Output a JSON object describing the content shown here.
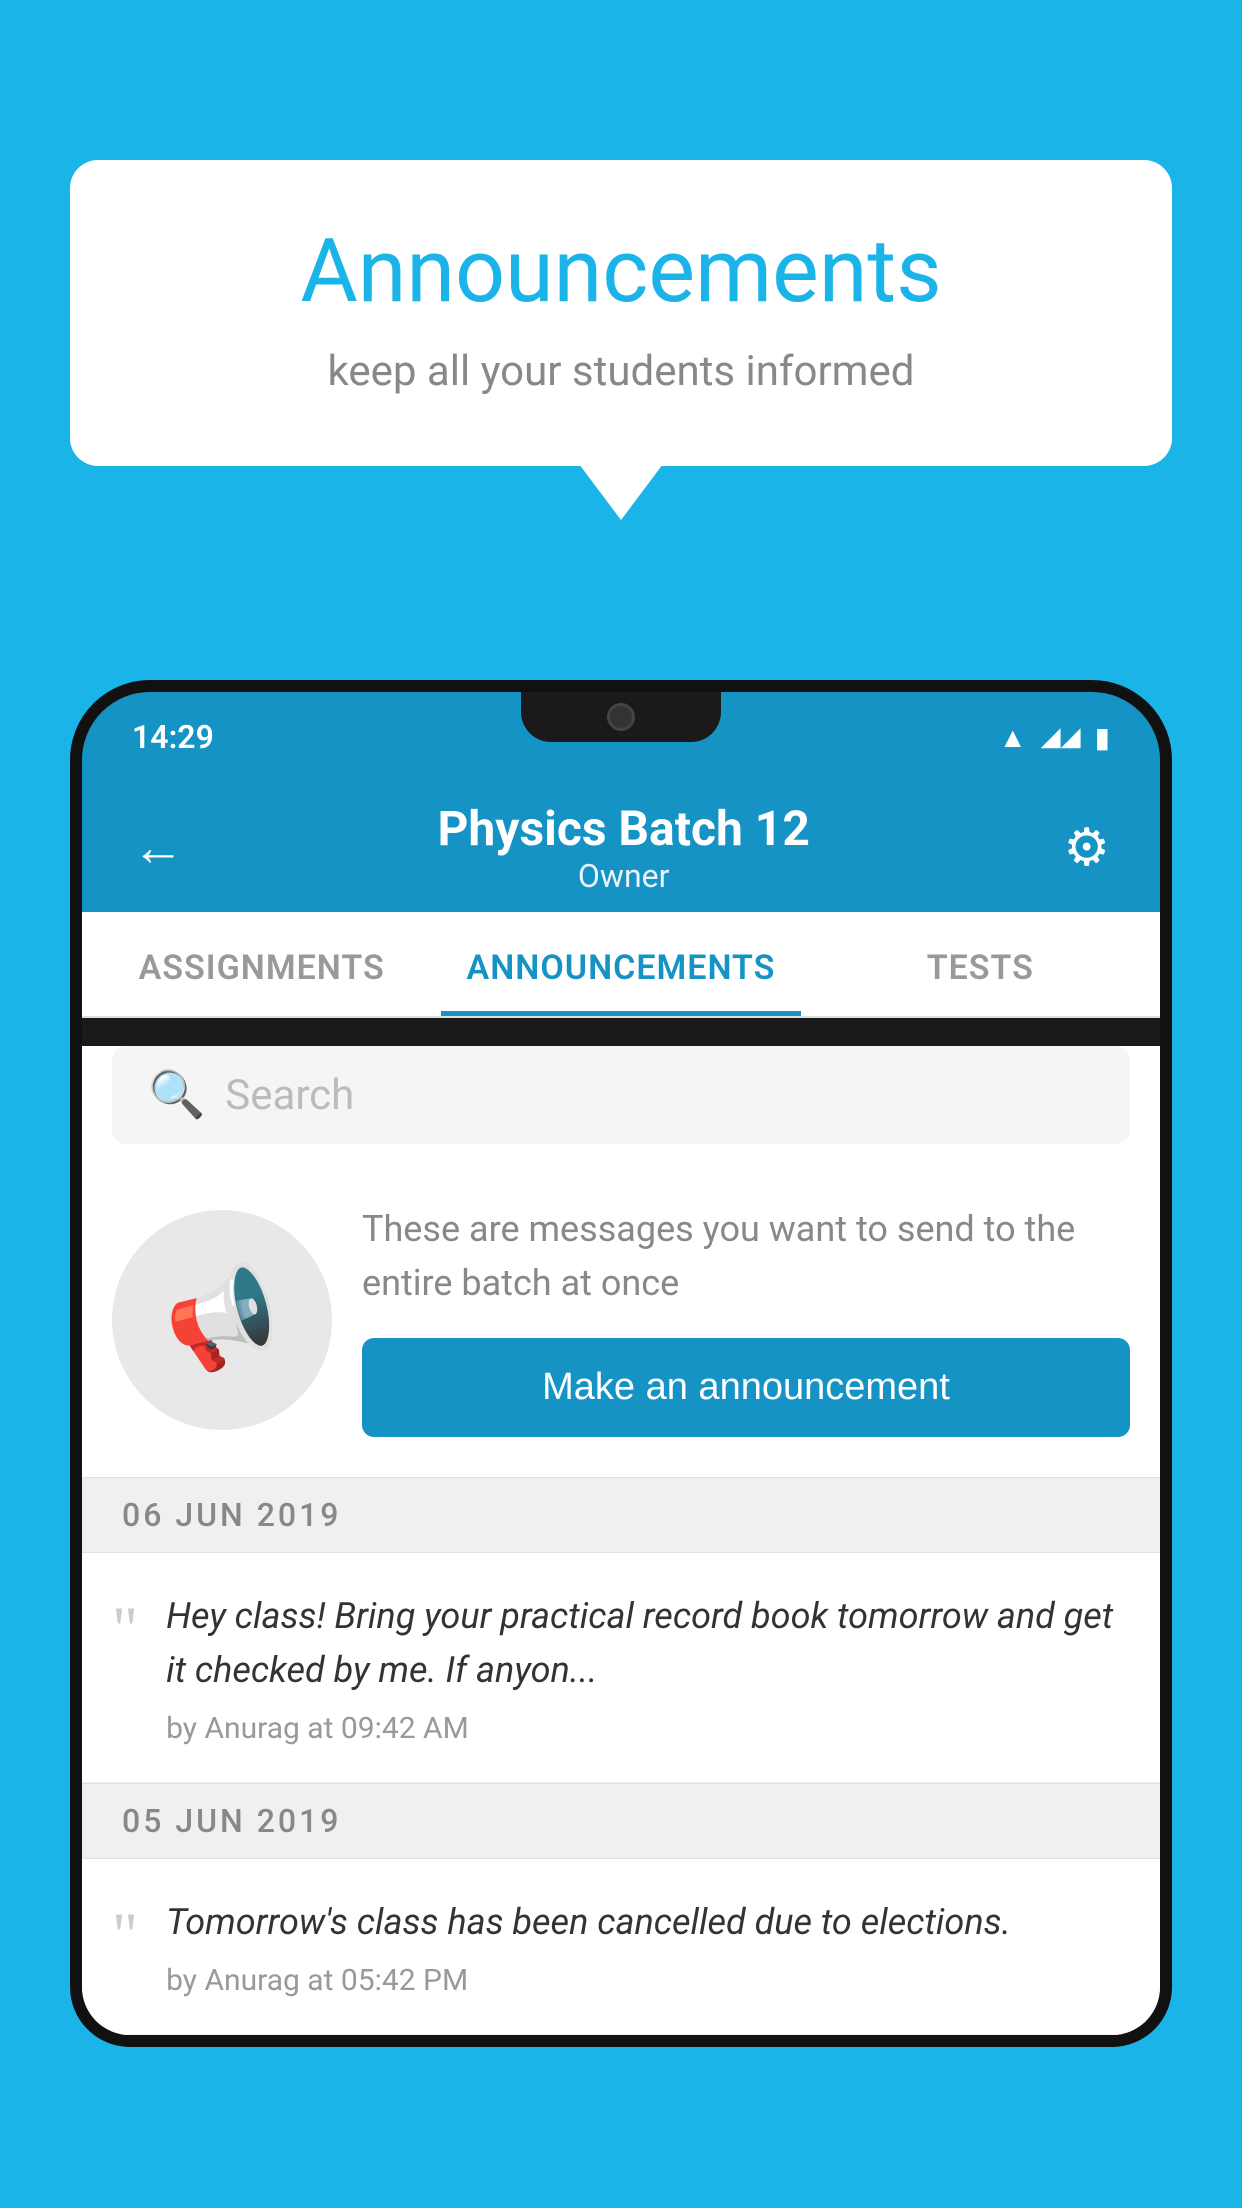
{
  "background_color": "#1ab4e8",
  "speech_bubble": {
    "title": "Announcements",
    "subtitle": "keep all your students informed"
  },
  "phone": {
    "status_bar": {
      "time": "14:29"
    },
    "header": {
      "back_label": "←",
      "title": "Physics Batch 12",
      "subtitle": "Owner",
      "gear_label": "⚙"
    },
    "tabs": [
      {
        "label": "ASSIGNMENTS",
        "active": false
      },
      {
        "label": "ANNOUNCEMENTS",
        "active": true
      },
      {
        "label": "TESTS",
        "active": false
      }
    ],
    "search": {
      "placeholder": "Search"
    },
    "promo": {
      "description": "These are messages you want to send to the entire batch at once",
      "button_label": "Make an announcement"
    },
    "announcements": [
      {
        "date": "06  JUN  2019",
        "text": "Hey class! Bring your practical record book tomorrow and get it checked by me. If anyon...",
        "meta": "by Anurag at 09:42 AM"
      },
      {
        "date": "05  JUN  2019",
        "text": "Tomorrow's class has been cancelled due to elections.",
        "meta": "by Anurag at 05:42 PM"
      }
    ]
  }
}
